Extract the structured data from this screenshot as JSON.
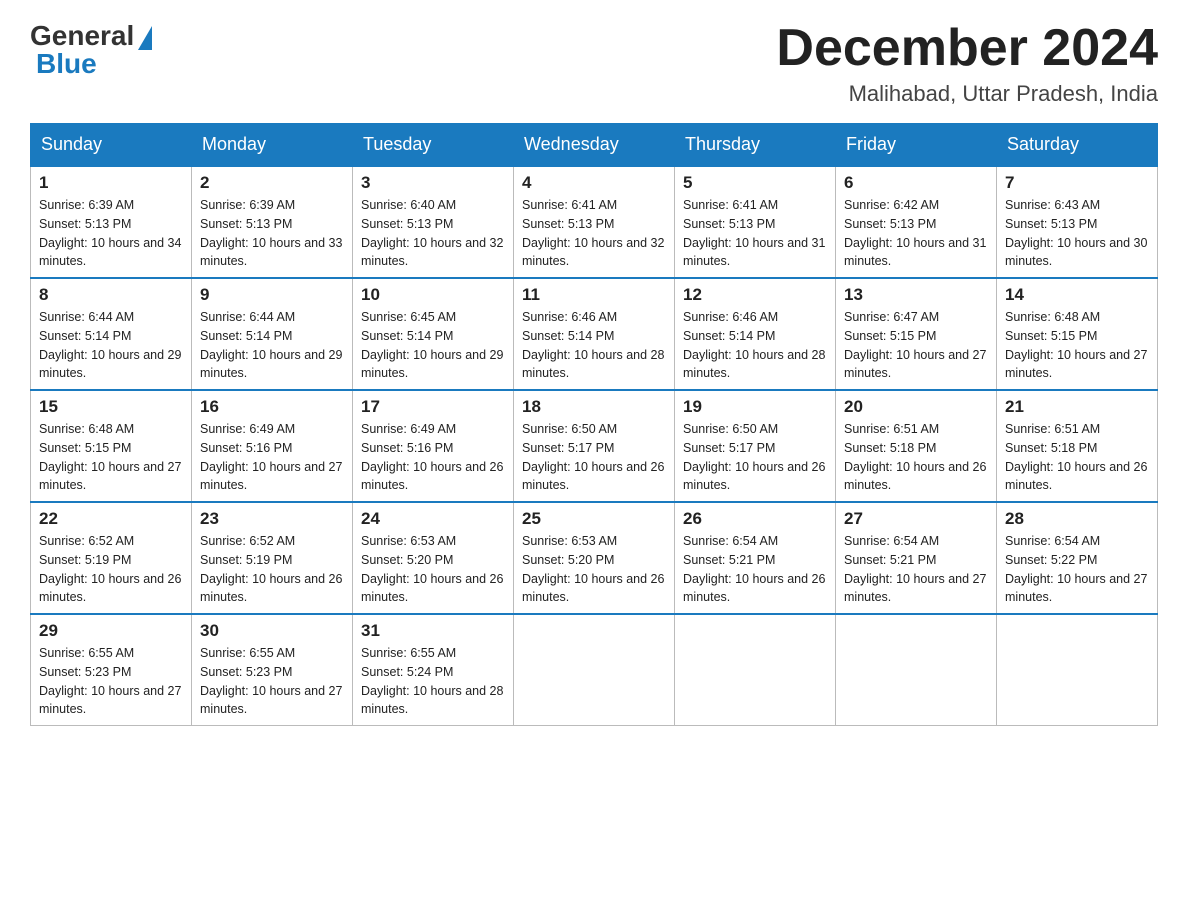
{
  "header": {
    "logo_general": "General",
    "logo_blue": "Blue",
    "title": "December 2024",
    "location": "Malihabad, Uttar Pradesh, India"
  },
  "days_of_week": [
    "Sunday",
    "Monday",
    "Tuesday",
    "Wednesday",
    "Thursday",
    "Friday",
    "Saturday"
  ],
  "weeks": [
    [
      {
        "day": "1",
        "sunrise": "6:39 AM",
        "sunset": "5:13 PM",
        "daylight": "10 hours and 34 minutes."
      },
      {
        "day": "2",
        "sunrise": "6:39 AM",
        "sunset": "5:13 PM",
        "daylight": "10 hours and 33 minutes."
      },
      {
        "day": "3",
        "sunrise": "6:40 AM",
        "sunset": "5:13 PM",
        "daylight": "10 hours and 32 minutes."
      },
      {
        "day": "4",
        "sunrise": "6:41 AM",
        "sunset": "5:13 PM",
        "daylight": "10 hours and 32 minutes."
      },
      {
        "day": "5",
        "sunrise": "6:41 AM",
        "sunset": "5:13 PM",
        "daylight": "10 hours and 31 minutes."
      },
      {
        "day": "6",
        "sunrise": "6:42 AM",
        "sunset": "5:13 PM",
        "daylight": "10 hours and 31 minutes."
      },
      {
        "day": "7",
        "sunrise": "6:43 AM",
        "sunset": "5:13 PM",
        "daylight": "10 hours and 30 minutes."
      }
    ],
    [
      {
        "day": "8",
        "sunrise": "6:44 AM",
        "sunset": "5:14 PM",
        "daylight": "10 hours and 29 minutes."
      },
      {
        "day": "9",
        "sunrise": "6:44 AM",
        "sunset": "5:14 PM",
        "daylight": "10 hours and 29 minutes."
      },
      {
        "day": "10",
        "sunrise": "6:45 AM",
        "sunset": "5:14 PM",
        "daylight": "10 hours and 29 minutes."
      },
      {
        "day": "11",
        "sunrise": "6:46 AM",
        "sunset": "5:14 PM",
        "daylight": "10 hours and 28 minutes."
      },
      {
        "day": "12",
        "sunrise": "6:46 AM",
        "sunset": "5:14 PM",
        "daylight": "10 hours and 28 minutes."
      },
      {
        "day": "13",
        "sunrise": "6:47 AM",
        "sunset": "5:15 PM",
        "daylight": "10 hours and 27 minutes."
      },
      {
        "day": "14",
        "sunrise": "6:48 AM",
        "sunset": "5:15 PM",
        "daylight": "10 hours and 27 minutes."
      }
    ],
    [
      {
        "day": "15",
        "sunrise": "6:48 AM",
        "sunset": "5:15 PM",
        "daylight": "10 hours and 27 minutes."
      },
      {
        "day": "16",
        "sunrise": "6:49 AM",
        "sunset": "5:16 PM",
        "daylight": "10 hours and 27 minutes."
      },
      {
        "day": "17",
        "sunrise": "6:49 AM",
        "sunset": "5:16 PM",
        "daylight": "10 hours and 26 minutes."
      },
      {
        "day": "18",
        "sunrise": "6:50 AM",
        "sunset": "5:17 PM",
        "daylight": "10 hours and 26 minutes."
      },
      {
        "day": "19",
        "sunrise": "6:50 AM",
        "sunset": "5:17 PM",
        "daylight": "10 hours and 26 minutes."
      },
      {
        "day": "20",
        "sunrise": "6:51 AM",
        "sunset": "5:18 PM",
        "daylight": "10 hours and 26 minutes."
      },
      {
        "day": "21",
        "sunrise": "6:51 AM",
        "sunset": "5:18 PM",
        "daylight": "10 hours and 26 minutes."
      }
    ],
    [
      {
        "day": "22",
        "sunrise": "6:52 AM",
        "sunset": "5:19 PM",
        "daylight": "10 hours and 26 minutes."
      },
      {
        "day": "23",
        "sunrise": "6:52 AM",
        "sunset": "5:19 PM",
        "daylight": "10 hours and 26 minutes."
      },
      {
        "day": "24",
        "sunrise": "6:53 AM",
        "sunset": "5:20 PM",
        "daylight": "10 hours and 26 minutes."
      },
      {
        "day": "25",
        "sunrise": "6:53 AM",
        "sunset": "5:20 PM",
        "daylight": "10 hours and 26 minutes."
      },
      {
        "day": "26",
        "sunrise": "6:54 AM",
        "sunset": "5:21 PM",
        "daylight": "10 hours and 26 minutes."
      },
      {
        "day": "27",
        "sunrise": "6:54 AM",
        "sunset": "5:21 PM",
        "daylight": "10 hours and 27 minutes."
      },
      {
        "day": "28",
        "sunrise": "6:54 AM",
        "sunset": "5:22 PM",
        "daylight": "10 hours and 27 minutes."
      }
    ],
    [
      {
        "day": "29",
        "sunrise": "6:55 AM",
        "sunset": "5:23 PM",
        "daylight": "10 hours and 27 minutes."
      },
      {
        "day": "30",
        "sunrise": "6:55 AM",
        "sunset": "5:23 PM",
        "daylight": "10 hours and 27 minutes."
      },
      {
        "day": "31",
        "sunrise": "6:55 AM",
        "sunset": "5:24 PM",
        "daylight": "10 hours and 28 minutes."
      },
      null,
      null,
      null,
      null
    ]
  ]
}
